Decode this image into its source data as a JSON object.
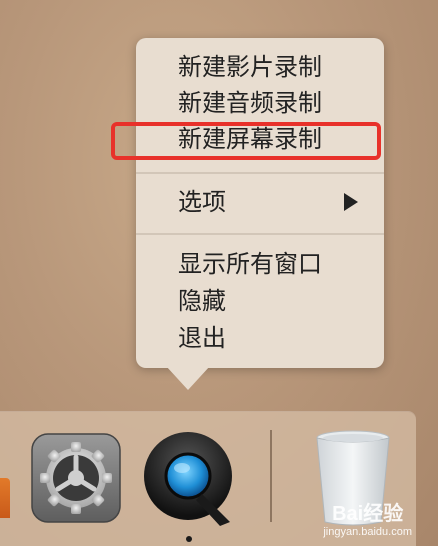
{
  "menu": {
    "items": [
      {
        "label": "新建影片录制"
      },
      {
        "label": "新建音频录制"
      },
      {
        "label": "新建屏幕录制"
      }
    ],
    "options_label": "选项",
    "window_items": [
      {
        "label": "显示所有窗口"
      },
      {
        "label": "隐藏"
      },
      {
        "label": "退出"
      }
    ]
  },
  "dock": {
    "apps": [
      {
        "icon": "system-preferences-icon"
      },
      {
        "icon": "quicktime-player-icon",
        "running": true
      },
      {
        "icon": "trash-icon"
      }
    ]
  },
  "watermark": {
    "logo": "Bai经验",
    "url": "jingyan.baidu.com"
  },
  "colors": {
    "highlight_border": "#e8312a",
    "menu_bg": "#e8ddd0"
  }
}
